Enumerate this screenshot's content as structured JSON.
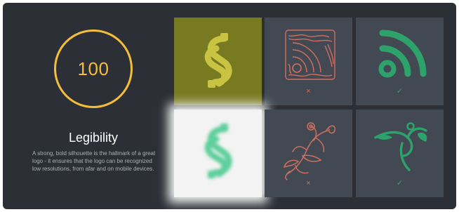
{
  "score": {
    "value": "100",
    "color": "#f4be3b"
  },
  "heading": "Legibility",
  "description": "A strong, bold silhouette is the hallmark of a great logo - it ensures that the logo can be recognized low resolutions, from afar and on mobile devices.",
  "tiles": [
    {
      "name": "bold-s-logo",
      "icon": "s-logo-icon",
      "background": "#787a21",
      "mark": ""
    },
    {
      "name": "detailed-rss-logo",
      "icon": "rss-detailed-icon",
      "background": "#424953",
      "mark": "×"
    },
    {
      "name": "simple-rss-logo",
      "icon": "rss-icon",
      "background": "#424953",
      "mark": "✓"
    },
    {
      "name": "blurred-s-logo",
      "icon": "s-logo-blurred-icon",
      "background": "#f2f3f2",
      "mark": ""
    },
    {
      "name": "ornate-vine-logo",
      "icon": "vine-ornate-icon",
      "background": "#424953",
      "mark": "×"
    },
    {
      "name": "simple-vine-logo",
      "icon": "vine-icon",
      "background": "#424953",
      "mark": "✓"
    }
  ],
  "colors": {
    "card_bg": "#2c3036",
    "tile_bg": "#424953",
    "accent_yellow": "#f4be3b",
    "good_green": "#2da36b",
    "bad_coral": "#cf705e",
    "s_logo_gold": "#c8c340",
    "s_logo_mint": "#5fcf9e"
  }
}
